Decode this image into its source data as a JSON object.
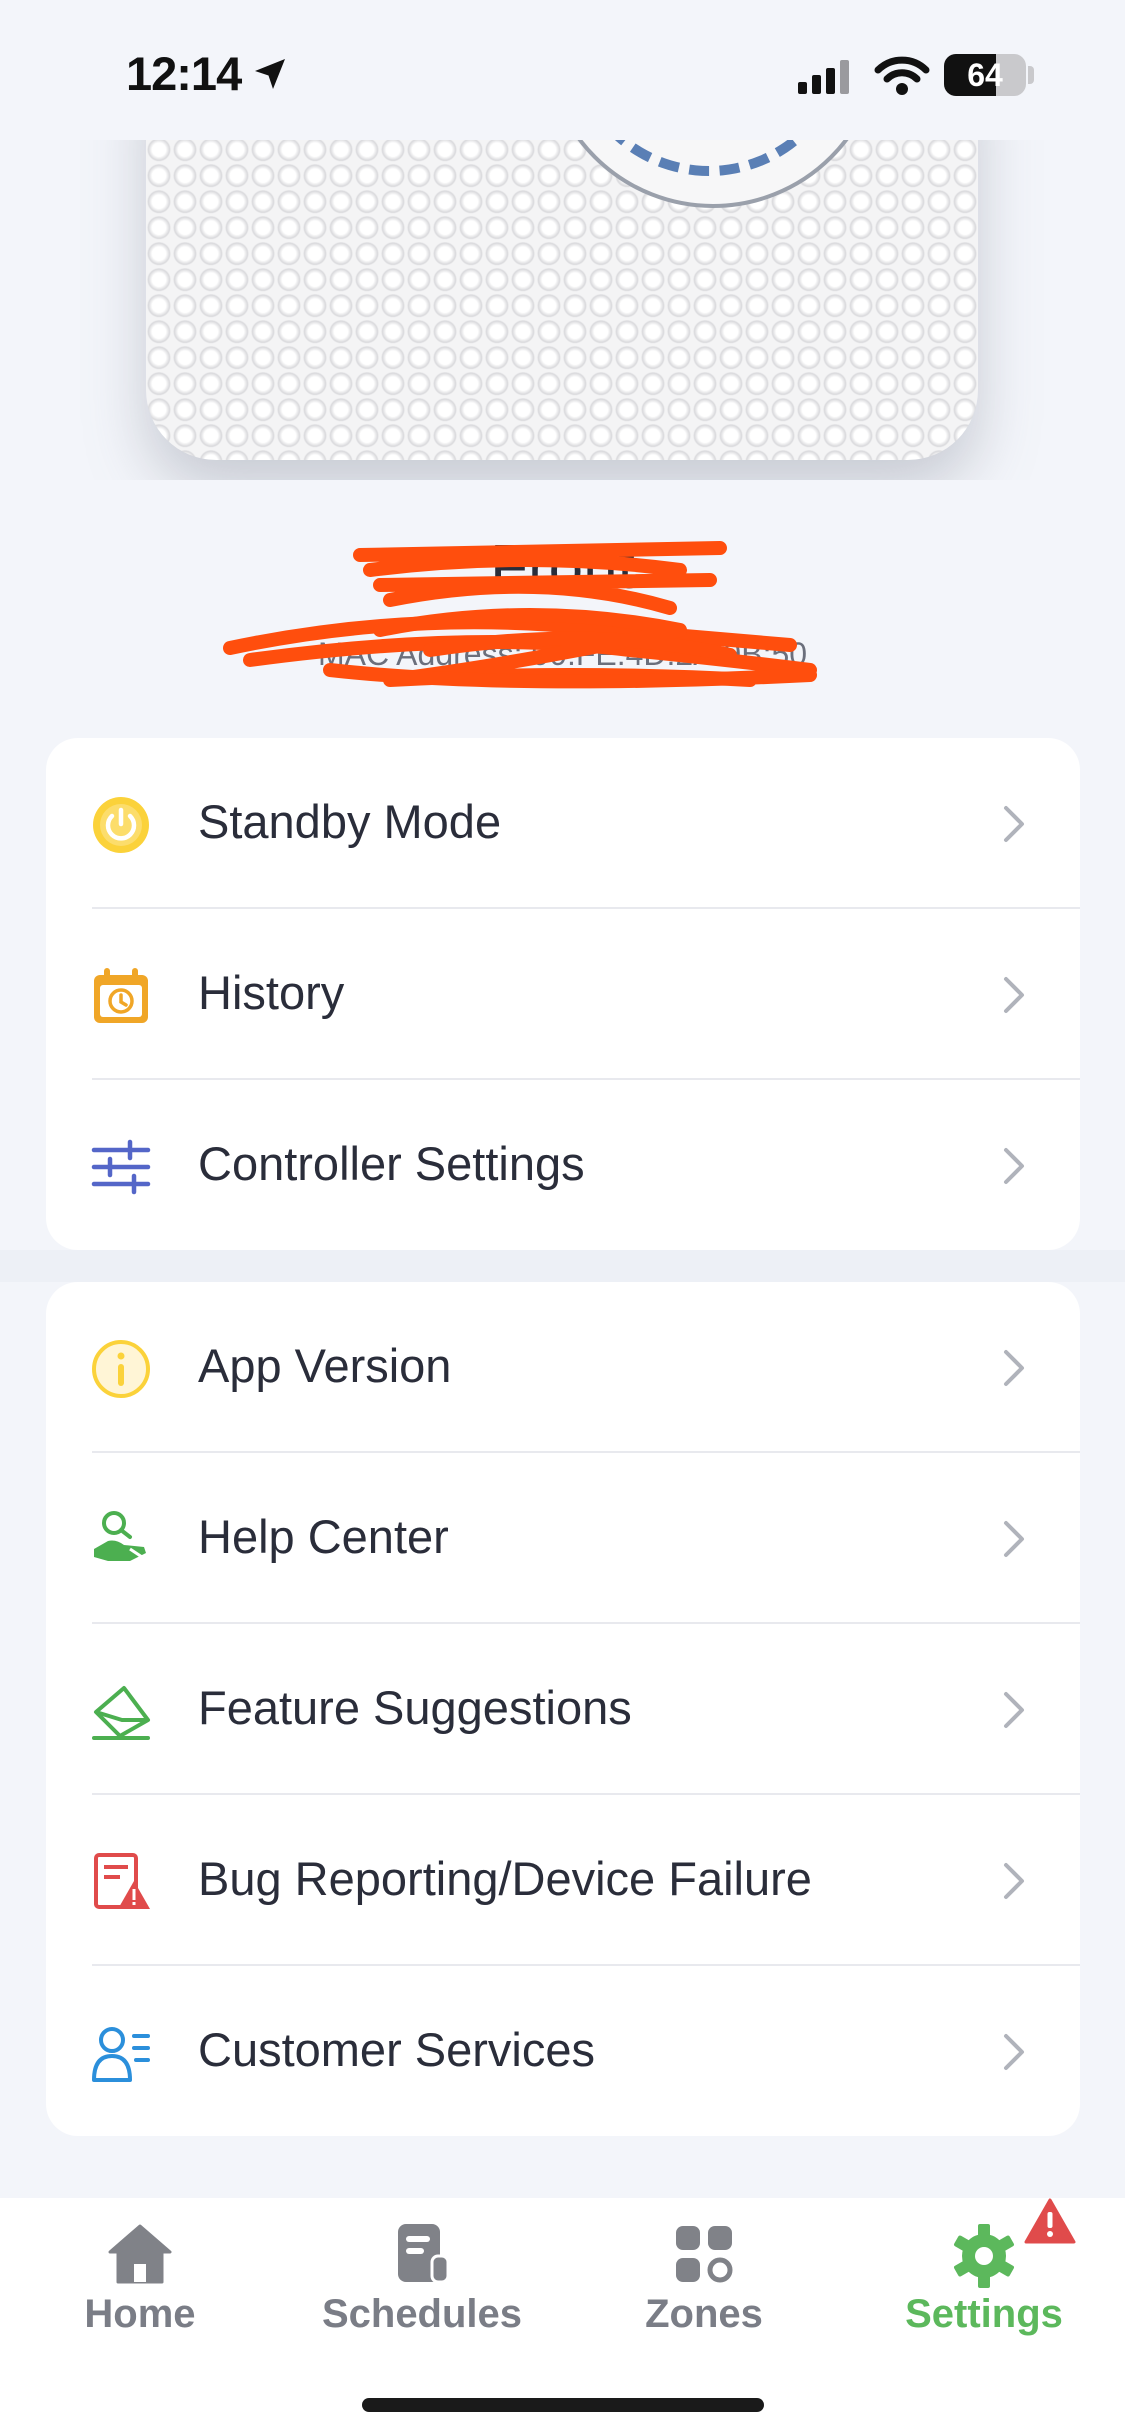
{
  "status_bar": {
    "time": "12:14",
    "battery": "64",
    "battery_level": 0.64
  },
  "device": {
    "name": "Front",
    "address": "MAC Address: 00:FE:4D:2A:9B:50"
  },
  "settings_group_1": [
    {
      "label": "Standby Mode",
      "icon": "power-icon"
    },
    {
      "label": "History",
      "icon": "history-calendar-icon"
    },
    {
      "label": "Controller Settings",
      "icon": "sliders-icon"
    }
  ],
  "settings_group_2": [
    {
      "label": "App Version",
      "icon": "info-icon"
    },
    {
      "label": "Help Center",
      "icon": "help-hand-icon"
    },
    {
      "label": "Feature Suggestions",
      "icon": "envelope-icon"
    },
    {
      "label": "Bug Reporting/Device Failure",
      "icon": "bug-report-icon"
    },
    {
      "label": "Customer Services",
      "icon": "customer-service-icon"
    }
  ],
  "tab_bar": {
    "tabs": [
      {
        "label": "Home",
        "icon": "home-icon"
      },
      {
        "label": "Schedules",
        "icon": "schedules-icon"
      },
      {
        "label": "Zones",
        "icon": "zones-icon"
      },
      {
        "label": "Settings",
        "icon": "gear-icon",
        "active": true
      }
    ]
  },
  "colors": {
    "accent_green": "#5cb85c",
    "alert_red": "#e04b4b",
    "redaction_orange": "#ff4e0d"
  }
}
